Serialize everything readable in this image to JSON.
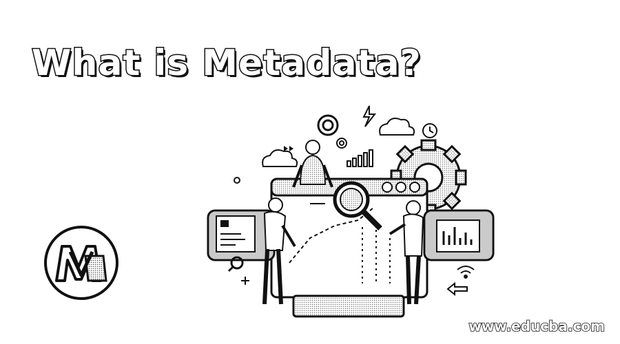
{
  "title": "What is Metadata?",
  "logo": {
    "name": "metadata-m-logo",
    "accent": "#111111"
  },
  "illustration": {
    "name": "data-analytics-illustration"
  },
  "footer": {
    "url": "www.educba.com"
  }
}
